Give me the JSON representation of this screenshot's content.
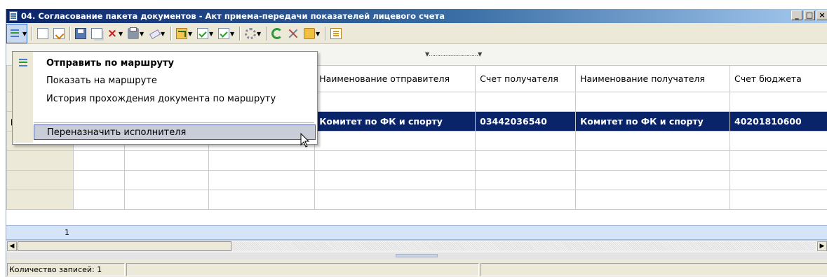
{
  "window": {
    "title": "04. Согласование пакета документов - Акт приема-передачи показателей лицевого счета",
    "minimize": "_",
    "maximize": "□",
    "close": "×"
  },
  "toolbar": {
    "icons": [
      "routes-icon",
      "new-doc-icon",
      "edit-doc-icon",
      "save-icon",
      "copy-icon",
      "delete-icon",
      "print-icon",
      "clear-icon",
      "route-doc-icon",
      "check-doc-icon",
      "check-doc2-icon",
      "gear-icon",
      "refresh-icon",
      "tools-icon",
      "folder-icon",
      "doc-link-icon"
    ]
  },
  "menu": {
    "items": [
      {
        "label": "Отправить по маршруту",
        "bold": true
      },
      {
        "label": "Показать на маршруте"
      },
      {
        "label": "История прохождения документа по маршруту"
      },
      {
        "label": "Переназначить исполнителя",
        "highlighted": true
      }
    ]
  },
  "grid": {
    "columns": [
      "Наименование отправителя",
      "Счет получателя",
      "Наименование получателя",
      "Счет бюджета"
    ],
    "rows": [
      {
        "sender_name": "Комитет по ФК и спорту",
        "recipient_account": "03442036540",
        "recipient_name": "Комитет по ФК и спорту",
        "budget_account": "40201810600"
      }
    ],
    "footer_count": "1"
  },
  "status": {
    "records": "Количество записей: 1"
  },
  "colors": {
    "title_bar": "#0a246a",
    "selection": "#0a246a",
    "footer": "#d6e4f8"
  }
}
